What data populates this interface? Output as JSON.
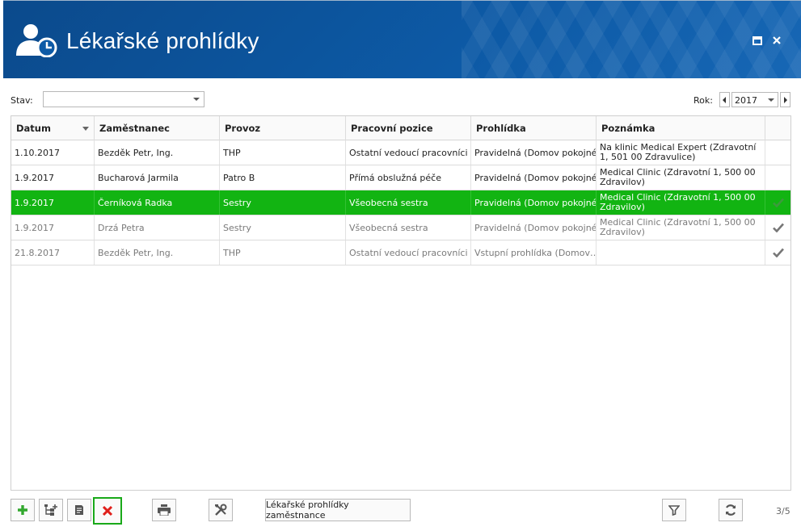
{
  "window": {
    "title": "Lékařské prohlídky"
  },
  "filters": {
    "stav_label": "Stav:",
    "stav_value": "",
    "rok_label": "Rok:",
    "rok_value": "2017"
  },
  "grid": {
    "columns": [
      "Datum",
      "Zaměstnanec",
      "Provoz",
      "Pracovní pozice",
      "Prohlídka",
      "Poznámka"
    ],
    "rows": [
      {
        "datum": "1.10.2017",
        "zamestnanec": "Bezděk Petr, Ing.",
        "provoz": "THP",
        "pozice": "Ostatní vedoucí pracovníci",
        "prohlidka": "Pravidelná (Domov pokojné…",
        "poznamka": "Na klinic Medical Expert (Zdravotní 1, 501 00 Zdravulice)",
        "checked": false,
        "state": "normal"
      },
      {
        "datum": "1.9.2017",
        "zamestnanec": "Bucharová Jarmila",
        "provoz": "Patro B",
        "pozice": "Přímá obslužná péče",
        "prohlidka": "Pravidelná (Domov pokojné…",
        "poznamka": "Medical Clinic (Zdravotní 1, 500 00 Zdravilov)",
        "checked": false,
        "state": "normal"
      },
      {
        "datum": "1.9.2017",
        "zamestnanec": "Černíková Radka",
        "provoz": "Sestry",
        "pozice": "Všeobecná sestra",
        "prohlidka": "Pravidelná (Domov pokojné…",
        "poznamka": "Medical Clinic (Zdravotní 1, 500 00 Zdravilov)",
        "checked": true,
        "state": "selected"
      },
      {
        "datum": "1.9.2017",
        "zamestnanec": "Drzá Petra",
        "provoz": "Sestry",
        "pozice": "Všeobecná sestra",
        "prohlidka": "Pravidelná (Domov pokojné…",
        "poznamka": "Medical Clinic (Zdravotní 1, 500 00 Zdravilov)",
        "checked": true,
        "state": "dim"
      },
      {
        "datum": "21.8.2017",
        "zamestnanec": "Bezděk Petr, Ing.",
        "provoz": "THP",
        "pozice": "Ostatní vedoucí pracovníci",
        "prohlidka": "Vstupní prohlídka (Domov…",
        "poznamka": "",
        "checked": true,
        "state": "dim"
      }
    ]
  },
  "toolbar": {
    "employee_checkups_label": "Lékařské prohlídky zaměstnance",
    "page_count": "3/5"
  },
  "icons": {
    "add": "plus-icon",
    "hierarchy": "tree-add-icon",
    "edit": "document-icon",
    "delete": "delete-x-icon",
    "print": "printer-icon",
    "settings": "tools-icon",
    "filter": "filter-icon",
    "refresh": "refresh-icon"
  },
  "colors": {
    "titlebar": "#0d5aa6",
    "selected_row": "#12b412",
    "delete_red": "#e0201b",
    "add_green": "#32a82e",
    "highlight_border": "#19a919"
  }
}
